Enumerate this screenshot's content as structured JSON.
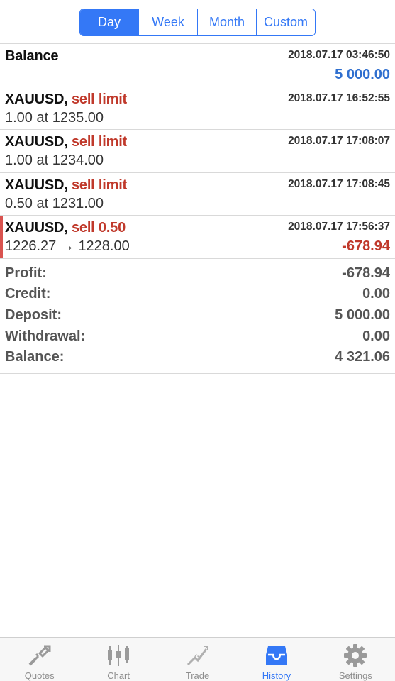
{
  "period_tabs": [
    {
      "label": "Day",
      "active": true
    },
    {
      "label": "Week",
      "active": false
    },
    {
      "label": "Month",
      "active": false
    },
    {
      "label": "Custom",
      "active": false
    }
  ],
  "history": [
    {
      "type": "balance",
      "title": "Balance",
      "time": "2018.07.17 03:46:50",
      "amount": "5 000.00",
      "amount_color": "#2f6fcf"
    },
    {
      "type": "order",
      "symbol": "XAUUSD,",
      "action": "sell limit",
      "time": "2018.07.17 16:52:55",
      "detail": "1.00 at 1235.00"
    },
    {
      "type": "order",
      "symbol": "XAUUSD,",
      "action": "sell limit",
      "time": "2018.07.17 17:08:07",
      "detail": "1.00 at 1234.00"
    },
    {
      "type": "order",
      "symbol": "XAUUSD,",
      "action": "sell limit",
      "time": "2018.07.17 17:08:45",
      "detail": "0.50 at 1231.00"
    },
    {
      "type": "deal",
      "symbol": "XAUUSD,",
      "action": "sell 0.50",
      "time": "2018.07.17 17:56:37",
      "detail": "1226.27 → 1228.00",
      "amount": "-678.94",
      "amount_color": "#c0392b",
      "selected": true
    }
  ],
  "summary": {
    "profit_label": "Profit:",
    "profit_value": "-678.94",
    "credit_label": "Credit:",
    "credit_value": "0.00",
    "deposit_label": "Deposit:",
    "deposit_value": "5 000.00",
    "withdrawal_label": "Withdrawal:",
    "withdrawal_value": "0.00",
    "balance_label": "Balance:",
    "balance_value": "4 321.06"
  },
  "tabbar": [
    {
      "label": "Quotes",
      "icon": "quotes-icon",
      "active": false
    },
    {
      "label": "Chart",
      "icon": "candlestick-chart-icon",
      "active": false
    },
    {
      "label": "Trade",
      "icon": "trade-icon",
      "active": false
    },
    {
      "label": "History",
      "icon": "history-inbox-icon",
      "active": true
    },
    {
      "label": "Settings",
      "icon": "gear-icon",
      "active": false
    }
  ],
  "colors": {
    "accent": "#3478f6",
    "loss": "#c0392b",
    "balance_positive": "#2f6fcf"
  }
}
